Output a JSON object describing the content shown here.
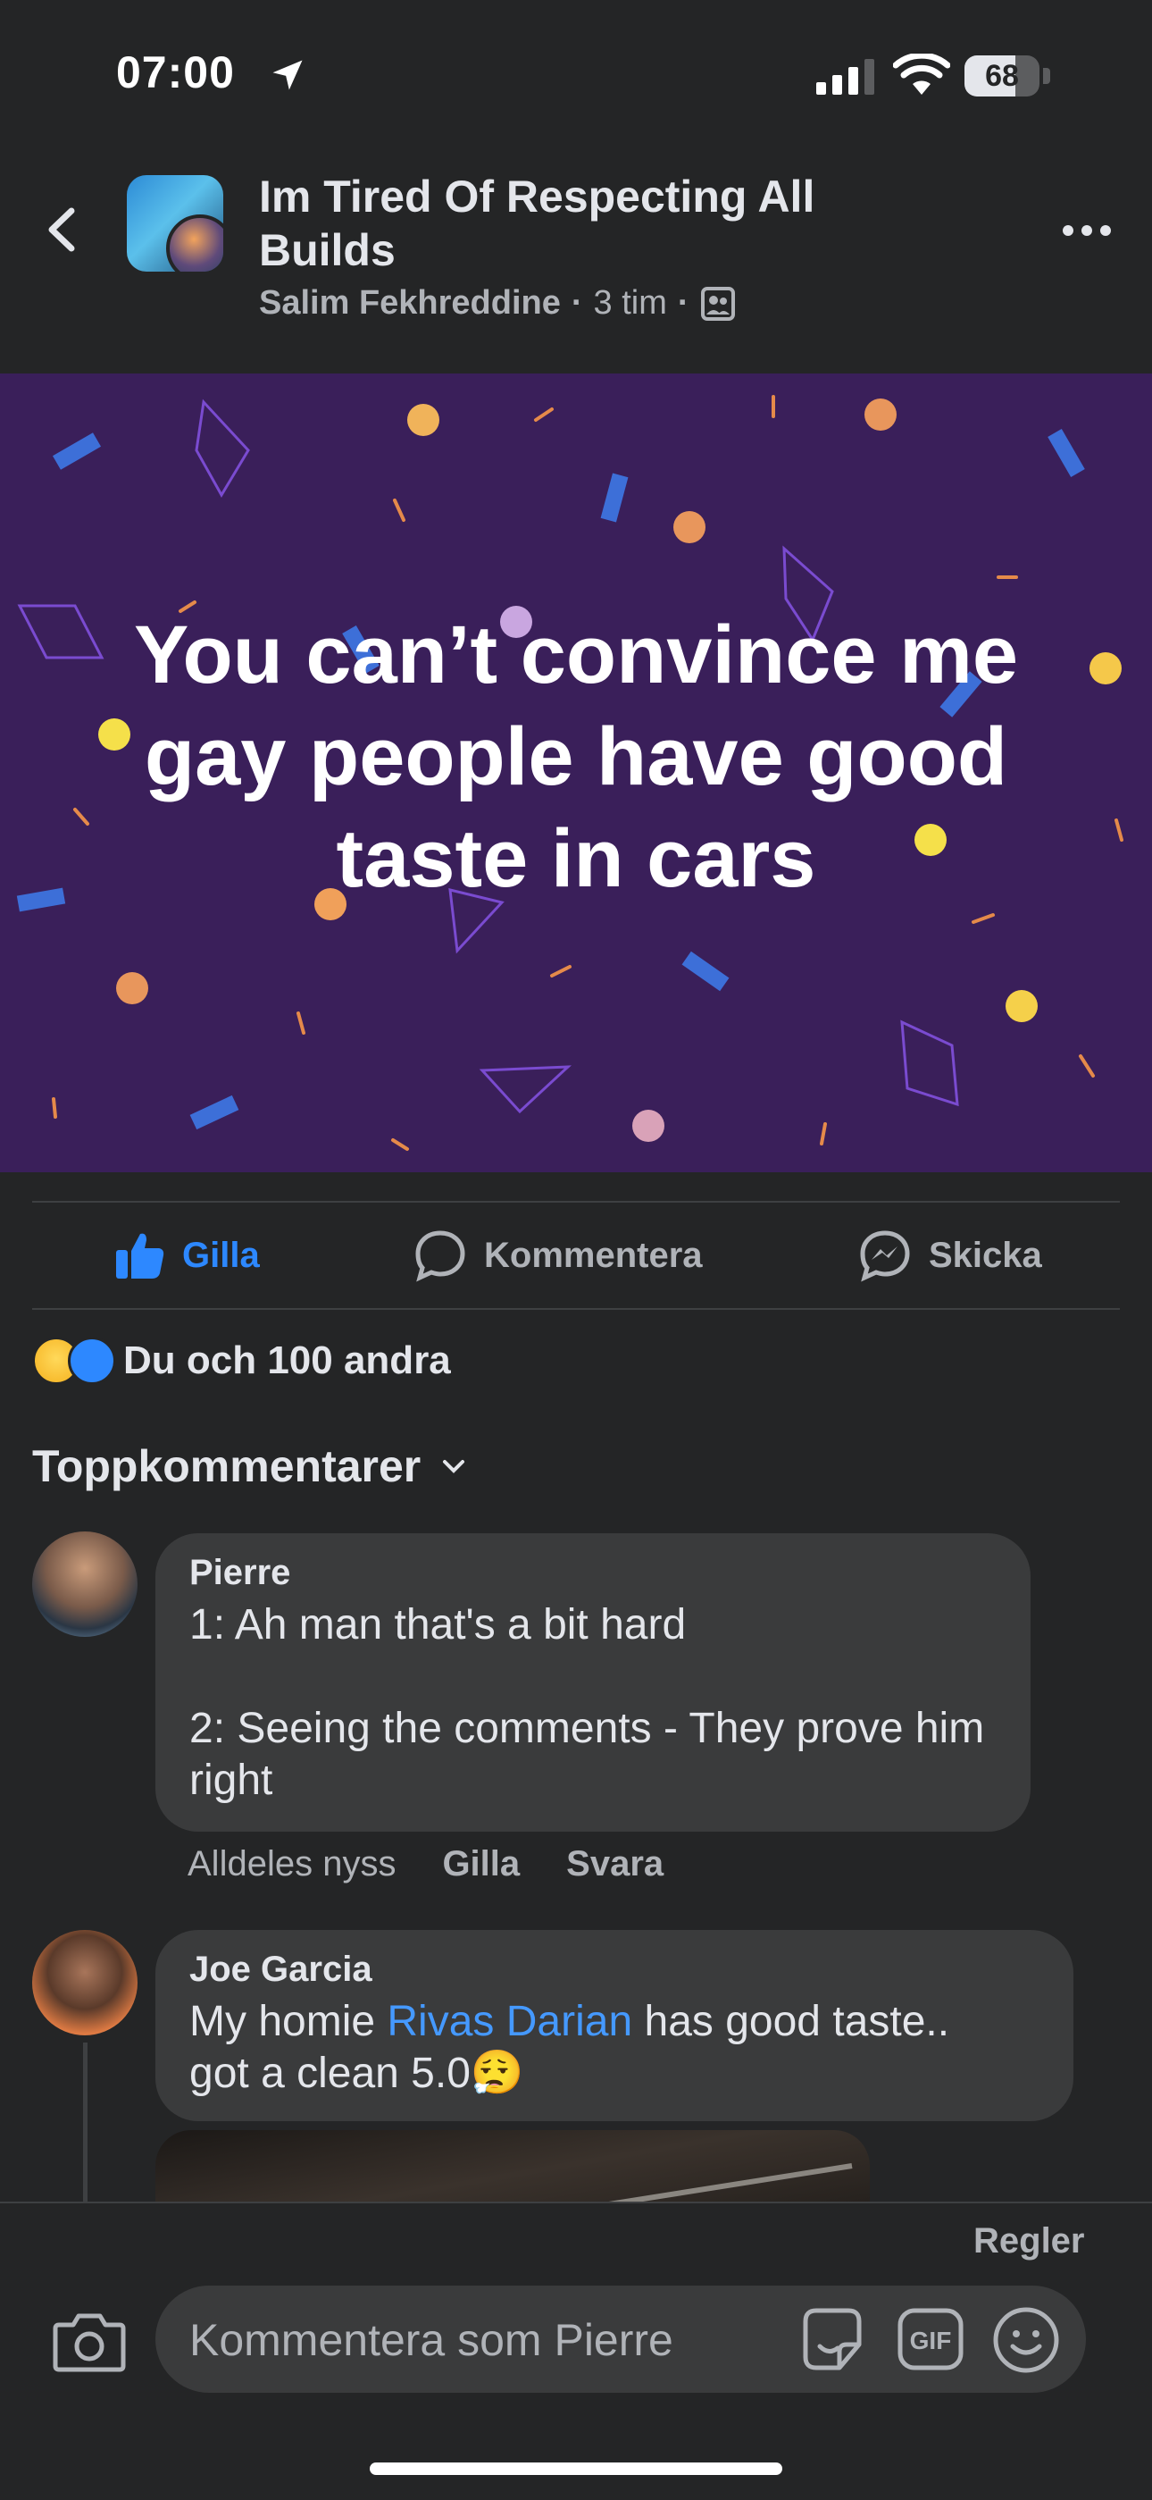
{
  "status_bar": {
    "time": "07:00",
    "battery": "68",
    "battery_level": 0.68
  },
  "header": {
    "group_name": "Im Tired Of Respecting All Builds",
    "author": "Salim Fekhreddine",
    "separator": "·",
    "time": "3 tim"
  },
  "post": {
    "text": "You can’t convince me gay people have good taste in cars"
  },
  "actions": {
    "like": "Gilla",
    "comment": "Kommentera",
    "share": "Skicka"
  },
  "reactions": {
    "summary": "Du och 100 andra"
  },
  "comments_header": {
    "label": "Toppkommentarer"
  },
  "comments": [
    {
      "name": "Pierre",
      "text": "1: Ah man that's a bit hard\n\n2: Seeing the comments - They prove him right",
      "timestamp": "Alldeles nyss",
      "like": "Gilla",
      "reply": "Svara"
    },
    {
      "name": "Joe Garcia",
      "text_before": "My homie ",
      "mention": "Rivas Darian",
      "text_after": " has good taste..\ngot a clean 5.0",
      "emoji": "😮‍💨"
    }
  ],
  "composer": {
    "rules": "Regler",
    "placeholder": "Kommentera som Pierre"
  },
  "colors": {
    "accent": "#2d88ff",
    "background": "#242526",
    "post_bg": "#3a1f5a",
    "bubble": "#3a3b3c"
  },
  "icons": [
    "location-arrow-icon",
    "signal-icon",
    "wifi-icon",
    "battery-icon",
    "back-chevron-icon",
    "more-dots-icon",
    "group-icon",
    "thumbs-up-icon",
    "comment-icon",
    "messenger-icon",
    "haha-reaction-icon",
    "like-reaction-icon",
    "chevron-down-icon",
    "camera-icon",
    "sticker-icon",
    "gif-icon",
    "emoji-icon"
  ]
}
